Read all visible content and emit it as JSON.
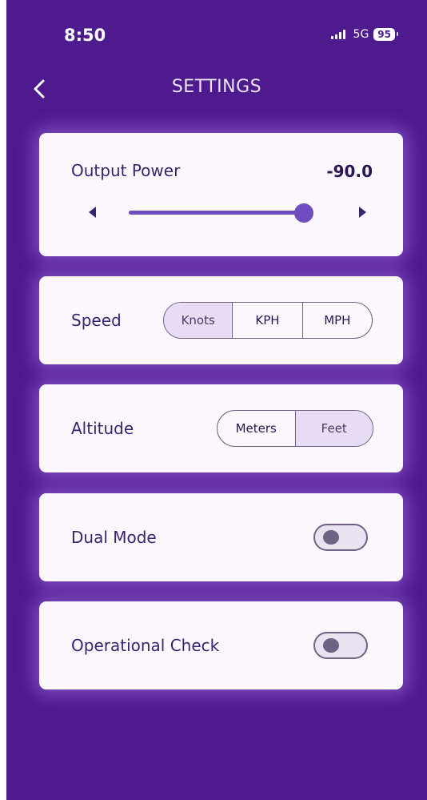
{
  "status": {
    "time": "8:50",
    "network": "5G",
    "battery": "95"
  },
  "header": {
    "title": "SETTINGS"
  },
  "output_power": {
    "label": "Output Power",
    "value": "-90.0",
    "slider_fraction": 0.96
  },
  "speed": {
    "label": "Speed",
    "options": [
      "Knots",
      "KPH",
      "MPH"
    ],
    "selected": "Knots"
  },
  "altitude": {
    "label": "Altitude",
    "options": [
      "Meters",
      "Feet"
    ],
    "selected": "Feet"
  },
  "dual_mode": {
    "label": "Dual Mode",
    "enabled": false
  },
  "operational_check": {
    "label": "Operational Check",
    "enabled": false
  },
  "colors": {
    "background": "#4e1b8e",
    "card": "#fbf8fd",
    "accent": "#6f4cbf",
    "selected_segment": "#e6dcf5"
  },
  "icons": {
    "back": "chevron-left-icon",
    "decrease": "triangle-left-icon",
    "increase": "triangle-right-icon",
    "signal": "signal-bars-icon",
    "battery": "battery-icon"
  }
}
